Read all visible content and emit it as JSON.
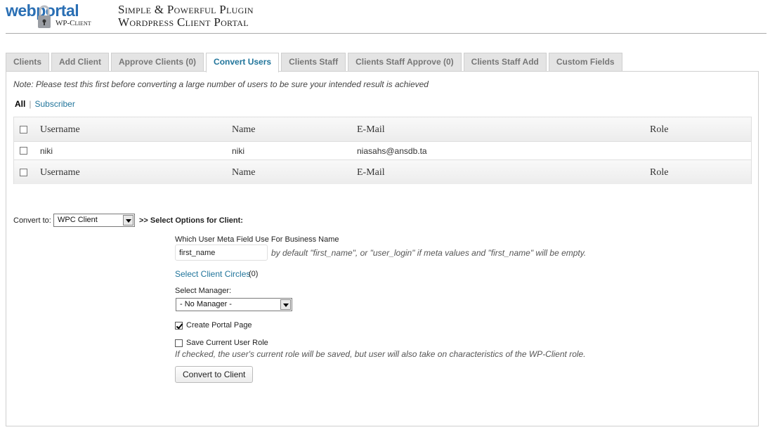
{
  "branding": {
    "logo_web": "web",
    "logo_portal": "portal",
    "logo_sub": "WP-Client",
    "tagline_line1": "Simple & Powerful Plugin",
    "tagline_line2": "Wordpress Client Portal"
  },
  "tabs": [
    {
      "label": "Clients",
      "active": false
    },
    {
      "label": "Add Client",
      "active": false
    },
    {
      "label": "Approve Clients (0)",
      "active": false
    },
    {
      "label": "Convert Users",
      "active": true
    },
    {
      "label": "Clients Staff",
      "active": false
    },
    {
      "label": "Clients Staff Approve (0)",
      "active": false
    },
    {
      "label": "Clients Staff Add",
      "active": false
    },
    {
      "label": "Custom Fields",
      "active": false
    }
  ],
  "note": "Note: Please test this first before converting a large number of users to be sure your intended result is achieved",
  "filters": {
    "all": "All",
    "separator": "|",
    "subscriber": "Subscriber"
  },
  "table": {
    "columns": [
      "Username",
      "Name",
      "E-Mail",
      "Role"
    ],
    "rows": [
      {
        "username": "niki",
        "name": "niki",
        "email": "niasahs@ansdb.ta",
        "role": ""
      }
    ]
  },
  "convert": {
    "label": "Convert to:",
    "selected": "WPC Client",
    "options_title": ">> Select Options for Client:",
    "meta_field_label": "Which User Meta Field Use For Business Name",
    "meta_field_value": "first_name",
    "meta_field_hint": "by default \"first_name\", or \"user_login\" if meta values and \"first_name\" will be empty.",
    "circles_link": "Select Client Circles",
    "circles_count": "(0)",
    "manager_label": "Select Manager:",
    "manager_selected": "- No Manager -",
    "create_portal_label": "Create Portal Page",
    "create_portal_checked": true,
    "save_role_label": "Save Current User Role",
    "save_role_checked": false,
    "save_role_hint": "If checked, the user's current role will be saved, but user will also take on characteristics of the WP-Client role.",
    "submit_label": "Convert to Client"
  },
  "colors": {
    "accent": "#21759b",
    "logo_blue": "#2a6fb4"
  }
}
